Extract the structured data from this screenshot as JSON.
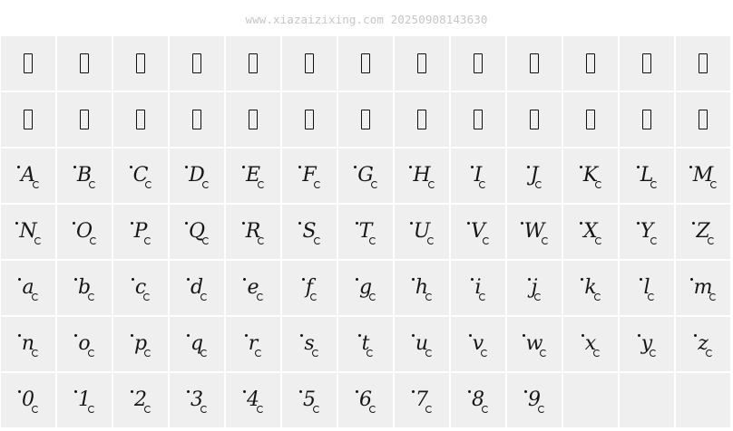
{
  "watermark": "www.xiazaizixing.com 20250908143630",
  "rows": [
    [
      "",
      "",
      "",
      "",
      "",
      "",
      "",
      "",
      "",
      "",
      "",
      "",
      ""
    ],
    [
      "",
      "",
      "",
      "",
      "",
      "",
      "",
      "",
      "",
      "",
      "",
      "",
      ""
    ],
    [
      "A",
      "B",
      "C",
      "D",
      "E",
      "F",
      "G",
      "H",
      "I",
      "J",
      "K",
      "L",
      "M"
    ],
    [
      "N",
      "O",
      "P",
      "Q",
      "R",
      "S",
      "T",
      "U",
      "V",
      "W",
      "X",
      "Y",
      "Z"
    ],
    [
      "a",
      "b",
      "c",
      "d",
      "e",
      "f",
      "g",
      "h",
      "i",
      "j",
      "k",
      "l",
      "m"
    ],
    [
      "n",
      "o",
      "p",
      "q",
      "r",
      "s",
      "t",
      "u",
      "v",
      "w",
      "x",
      "y",
      "z"
    ],
    [
      "0",
      "1",
      "2",
      "3",
      "4",
      "5",
      "6",
      "7",
      "8",
      "9",
      "",
      "",
      ""
    ]
  ],
  "cell_kinds": [
    [
      "tofu",
      "tofu",
      "tofu",
      "tofu",
      "tofu",
      "tofu",
      "tofu",
      "tofu",
      "tofu",
      "tofu",
      "tofu",
      "tofu",
      "tofu"
    ],
    [
      "tofu",
      "tofu",
      "tofu",
      "tofu",
      "tofu",
      "tofu",
      "tofu",
      "tofu",
      "tofu",
      "tofu",
      "tofu",
      "tofu",
      "tofu"
    ],
    [
      "glyph",
      "glyph",
      "glyph",
      "glyph",
      "glyph",
      "glyph",
      "glyph",
      "glyph",
      "glyph",
      "glyph",
      "glyph",
      "glyph",
      "glyph"
    ],
    [
      "glyph",
      "glyph",
      "glyph",
      "glyph",
      "glyph",
      "glyph",
      "glyph",
      "glyph",
      "glyph",
      "glyph",
      "glyph",
      "glyph",
      "glyph"
    ],
    [
      "glyph",
      "glyph",
      "glyph",
      "glyph",
      "glyph",
      "glyph",
      "glyph",
      "glyph",
      "glyph",
      "glyph",
      "glyph",
      "glyph",
      "glyph"
    ],
    [
      "glyph",
      "glyph",
      "glyph",
      "glyph",
      "glyph",
      "glyph",
      "glyph",
      "glyph",
      "glyph",
      "glyph",
      "glyph",
      "glyph",
      "glyph"
    ],
    [
      "glyph",
      "glyph",
      "glyph",
      "glyph",
      "glyph",
      "glyph",
      "glyph",
      "glyph",
      "glyph",
      "glyph",
      "empty",
      "empty",
      "empty"
    ]
  ],
  "colors": {
    "cell_background": "#efefef",
    "glyph_ink": "#151515",
    "watermark": "#c6c6c6",
    "page_background": "#ffffff"
  }
}
